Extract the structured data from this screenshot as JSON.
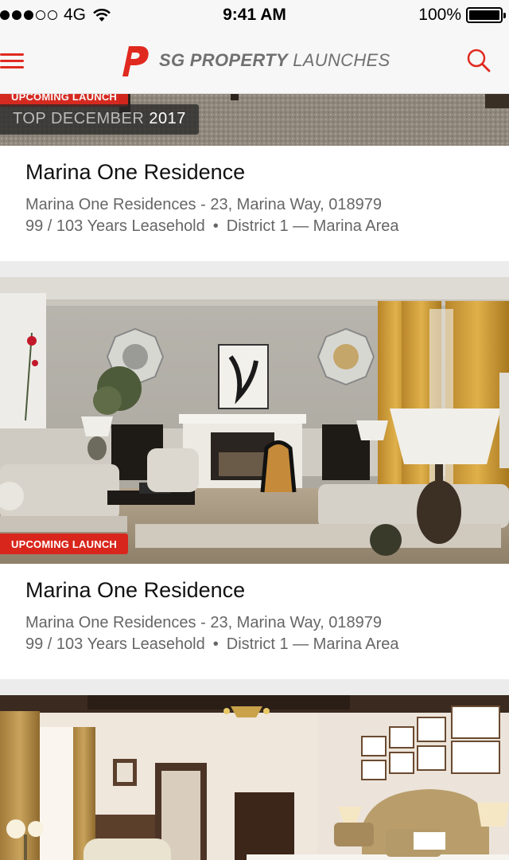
{
  "status_bar": {
    "carrier": "4G",
    "time": "9:41 AM",
    "battery": "100%",
    "signal_bars_filled": 3,
    "signal_bars_total": 5
  },
  "nav": {
    "brand_bold": "SG PROPERTY",
    "brand_light": "LAUNCHES",
    "accent_color": "#e02a20",
    "icons": [
      "menu-icon",
      "brand-logo-icon",
      "search-icon"
    ]
  },
  "cards": [
    {
      "badge": "UPCOMING LAUNCH",
      "date_prefix": "TOP DECEMBER",
      "date_year": "2017",
      "title": "Marina One Residence",
      "address": "Marina One Residences - 23, Marina Way, 018979",
      "tenure": "99 / 103 Years Leasehold",
      "separator": "•",
      "district": "District 1 — Marina Area"
    },
    {
      "badge": "UPCOMING LAUNCH",
      "title": "Marina One Residence",
      "address": "Marina One Residences - 23, Marina Way, 018979",
      "tenure": "99 / 103 Years Leasehold",
      "separator": "•",
      "district": "District 1 — Marina Area"
    },
    {
      "title": ""
    }
  ]
}
